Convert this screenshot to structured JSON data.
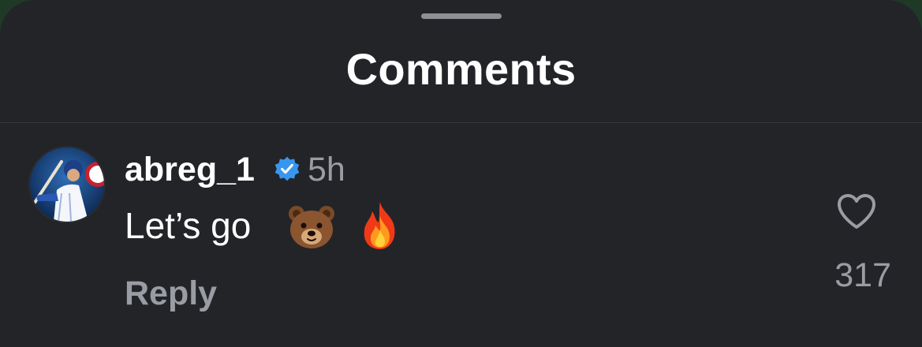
{
  "sheet": {
    "title": "Comments"
  },
  "comment": {
    "username": "abreg_1",
    "verified": true,
    "timestamp": "5h",
    "text": "Let’s go",
    "emojis": [
      "bear-face",
      "fire"
    ],
    "reply_label": "Reply",
    "like_count": "317"
  },
  "colors": {
    "sheet_background": "#232428",
    "primary_text": "#ffffff",
    "secondary_text": "#9a9ca3",
    "verified_badge": "#3797f0"
  },
  "icons": {
    "verified": "verified-badge-icon",
    "like": "heart-outline-icon"
  }
}
